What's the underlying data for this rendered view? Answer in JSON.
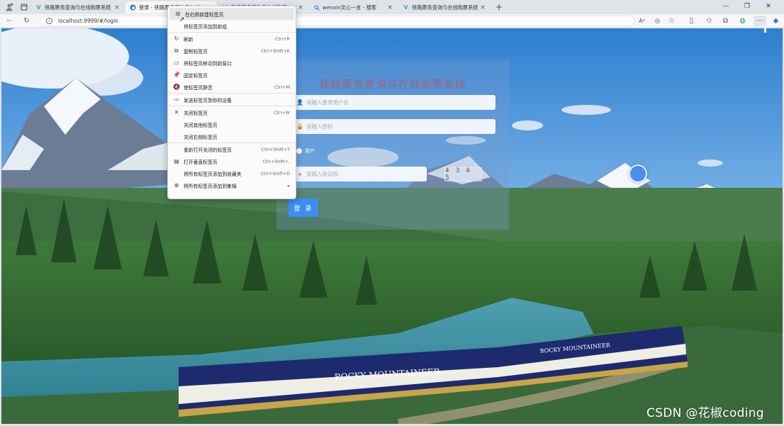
{
  "browser": {
    "tabs": [
      {
        "title": "铁路票务查询与在线购票系统",
        "favicon": "vue-icon",
        "active": false
      },
      {
        "title": "登录 - 铁路票务查询与在线购票系",
        "favicon": "edge-icon",
        "active": true
      },
      {
        "title": "铁路票务查询与在线购票系统",
        "favicon": "vue-icon",
        "active": false
      },
      {
        "title": "wenxin文心一言 - 搜索",
        "favicon": "search-icon",
        "active": false
      },
      {
        "title": "铁路票务查询与在线购票系统",
        "favicon": "vue-icon",
        "active": false
      }
    ],
    "new_tab_symbol": "+",
    "address": "localhost:9999/#/login"
  },
  "context_menu": {
    "items": [
      {
        "label": "在右侧新建标签页",
        "shortcut": "",
        "icon": "new-tab-icon",
        "highlighted": true
      },
      {
        "label": "将标签页添加到新组",
        "shortcut": "",
        "icon": "",
        "highlighted": false
      },
      {
        "separator": true
      },
      {
        "label": "刷新",
        "shortcut": "Ctrl+R",
        "icon": "refresh-icon"
      },
      {
        "label": "复制标签页",
        "shortcut": "Ctrl+Shift+K",
        "icon": "duplicate-icon"
      },
      {
        "label": "将标签页移动到新窗口",
        "shortcut": "",
        "icon": "move-window-icon"
      },
      {
        "label": "固定标签页",
        "shortcut": "",
        "icon": "pin-icon"
      },
      {
        "label": "使标签页静音",
        "shortcut": "Ctrl+M",
        "icon": "mute-icon"
      },
      {
        "separator": true
      },
      {
        "label": "发送标签页到你的设备",
        "shortcut": "",
        "icon": "send-device-icon"
      },
      {
        "separator": true
      },
      {
        "label": "关闭标签页",
        "shortcut": "Ctrl+W",
        "icon": "close-icon"
      },
      {
        "label": "关闭其他标签页",
        "shortcut": "",
        "icon": ""
      },
      {
        "label": "关闭右侧标签页",
        "shortcut": "",
        "icon": ""
      },
      {
        "separator": true
      },
      {
        "label": "重新打开关闭的标签页",
        "shortcut": "Ctrl+Shift+T",
        "icon": ""
      },
      {
        "label": "打开垂直标签页",
        "shortcut": "Ctrl+Shift+,",
        "icon": "vertical-tabs-icon"
      },
      {
        "label": "将所有标签页添加到收藏夹",
        "shortcut": "Ctrl+Shift+D",
        "icon": ""
      },
      {
        "label": "将所有标签页添加到集锦",
        "shortcut": "",
        "icon": "collections-icon",
        "submenu": true
      }
    ]
  },
  "login": {
    "title": "铁路票务查询与在线购票系统",
    "username_placeholder": "请输入登录用户名",
    "password_placeholder": "请输入密码",
    "role_label": "用户",
    "captcha_placeholder": "请输入验证码",
    "captcha_code": "4 3 4 5",
    "login_button": "登 录"
  },
  "watermark": "CSDN @花椒coding",
  "colors": {
    "login_button": "#3d8ef0",
    "title": "#d33a3a",
    "tab_strip": "#dfe3ea"
  }
}
